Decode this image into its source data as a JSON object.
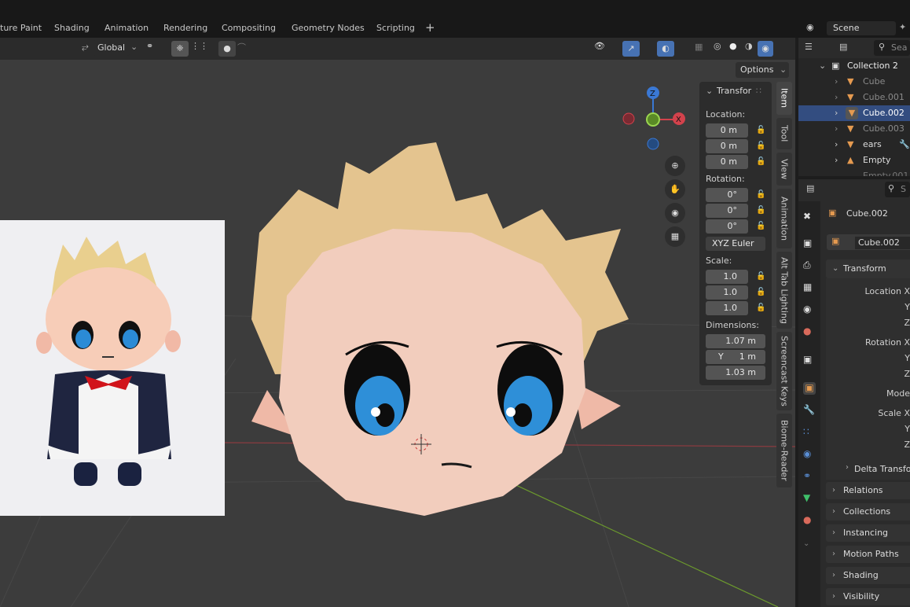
{
  "workspace_tabs": [
    "ture Paint",
    "Shading",
    "Animation",
    "Rendering",
    "Compositing",
    "Geometry Nodes",
    "Scripting",
    "+"
  ],
  "scene": {
    "name": "Scene"
  },
  "viewport_header": {
    "transform_orientation": "Global",
    "options_label": "Options"
  },
  "npanel": {
    "title": "Transfor",
    "location_label": "Location:",
    "location": [
      "0 m",
      "0 m",
      "0 m"
    ],
    "rotation_label": "Rotation:",
    "rotation": [
      "0°",
      "0°",
      "0°"
    ],
    "rotation_mode": "XYZ Euler",
    "scale_label": "Scale:",
    "scale": [
      "1.0",
      "1.0",
      "1.0"
    ],
    "dimensions_label": "Dimensions:",
    "dimensions": [
      "1.07 m",
      "1 m",
      "1.03 m"
    ],
    "dimension_axis_y": "Y"
  },
  "side_tabs": [
    "Item",
    "Tool",
    "View",
    "Animation",
    "Alt Tab Lighting",
    "Screencast Keys",
    "Biome-Reader"
  ],
  "gizmo": {
    "z": "Z",
    "x": "X"
  },
  "outliner": {
    "search_placeholder": "Sea",
    "collection": "Collection 2",
    "items": [
      "Cube",
      "Cube.001",
      "Cube.002",
      "Cube.003",
      "ears",
      "Empty",
      "Empty.001"
    ]
  },
  "properties": {
    "search_placeholder": "S",
    "object_name": "Cube.002",
    "mesh_name": "Cube.002",
    "transform_label": "Transform",
    "rows": [
      "Location X",
      "Y",
      "Z",
      "Rotation X",
      "Y",
      "Z",
      "Mode",
      "Scale X",
      "Y",
      "Z"
    ],
    "delta_label": "Delta Transfo",
    "sections": [
      "Relations",
      "Collections",
      "Instancing",
      "Motion Paths",
      "Shading",
      "Visibility"
    ]
  },
  "colors": {
    "accent": "#4772b3",
    "x_axis": "#d3424c",
    "y_axis": "#7fb83b",
    "z_axis": "#3a78d4"
  }
}
